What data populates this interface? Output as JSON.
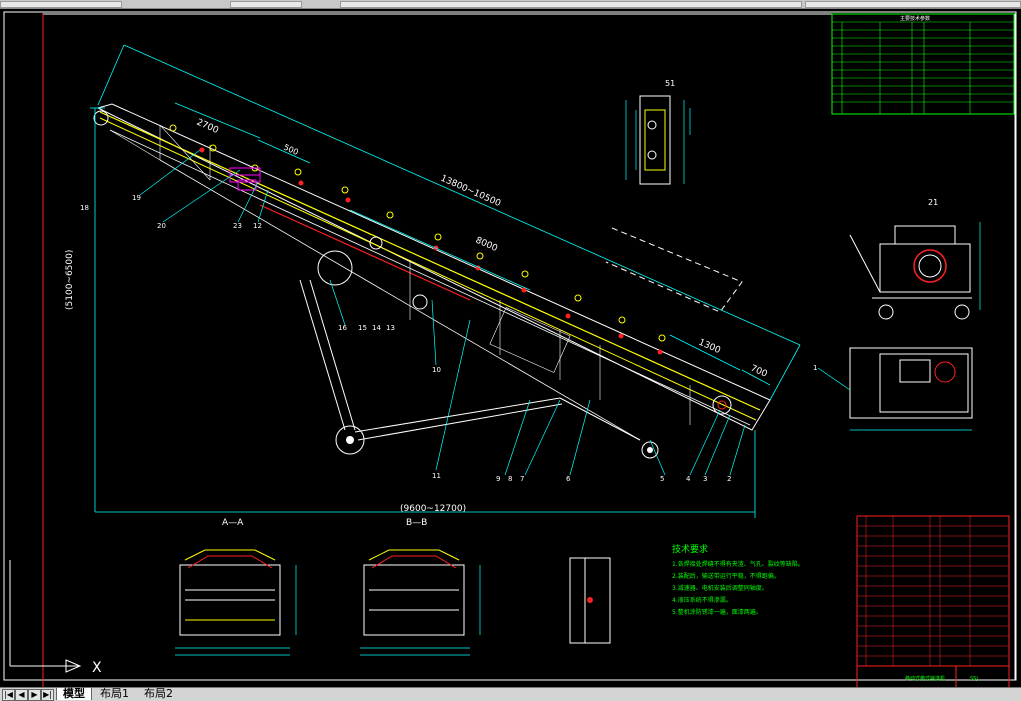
{
  "window": {
    "title_bar_segments": 4
  },
  "drawing": {
    "dimensions": {
      "total_length": "(9600~12700)",
      "height": "(5100~6500)",
      "span_main": "13800~10500",
      "span_inner": "8000",
      "top_dim": "2700",
      "dim_500": "500",
      "dim_1300": "1300",
      "dim_700": "700"
    },
    "callouts": [
      "18",
      "19",
      "20",
      "23",
      "12",
      "16",
      "15",
      "14",
      "13",
      "10",
      "11",
      "9",
      "8",
      "7",
      "6",
      "5",
      "4",
      "3",
      "2",
      "1",
      "21"
    ],
    "section_labels": {
      "aa": "A—A",
      "bb": "B—B",
      "view51": "51",
      "view21": "21"
    },
    "tech_requirements": {
      "title": "技术要求",
      "lines": [
        "1.各焊接处焊缝不得有夹渣、气孔、裂纹等缺陷。",
        "2.装配后，输送带运行平稳，不得跑偏。",
        "3.减速器、电机安装后调整同轴度。",
        "4.液压系统不得渗漏。",
        "5.整机涂防锈漆一遍，面漆两遍。"
      ]
    },
    "table_top": {
      "title": "主要技术参数"
    },
    "title_block": {
      "title": "移动式带式输送机",
      "drawing_no": "SSJ"
    }
  },
  "ucs": {
    "x_label": "X"
  },
  "tabs": {
    "nav": [
      "|◀",
      "◀",
      "▶",
      "▶|"
    ],
    "items": [
      "模型",
      "布局1",
      "布局2"
    ],
    "active": 0
  },
  "colors": {
    "background": "#000000",
    "yellow": "#ffff00",
    "cyan": "#00ffff",
    "green": "#00ff00",
    "red": "#ff2020",
    "magenta": "#ff00ff",
    "white": "#ffffff"
  }
}
